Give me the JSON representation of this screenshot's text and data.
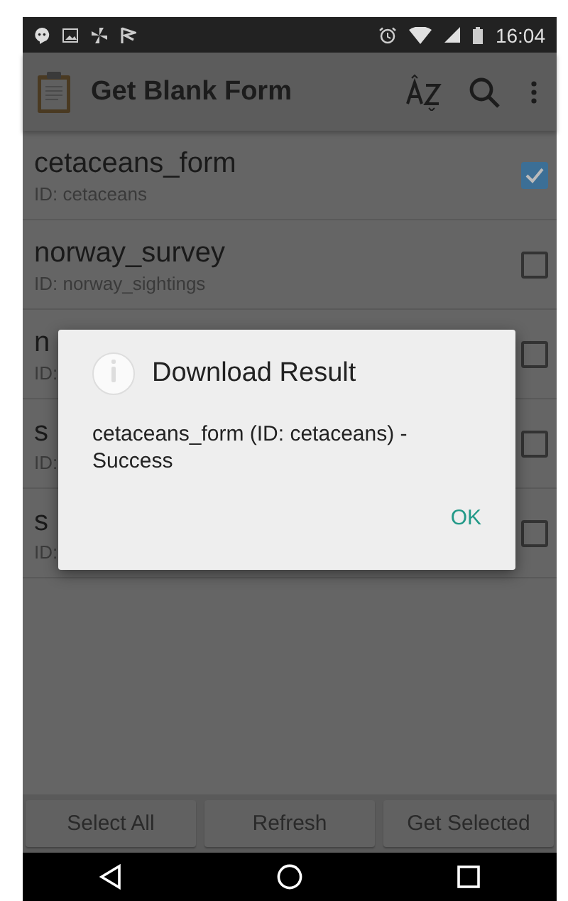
{
  "status_bar": {
    "time": "16:04"
  },
  "app_bar": {
    "title": "Get Blank Form"
  },
  "forms": [
    {
      "name": "cetaceans_form",
      "id_text": "ID: cetaceans",
      "checked": true
    },
    {
      "name": "norway_survey",
      "id_text": "ID: norway_sightings",
      "checked": false
    },
    {
      "name": "n",
      "id_text": "ID:",
      "checked": false
    },
    {
      "name": "s",
      "id_text": "ID:",
      "checked": false
    },
    {
      "name": "s",
      "id_text": "ID:",
      "checked": false
    }
  ],
  "buttons": [
    "Select All",
    "Refresh",
    "Get Selected"
  ],
  "dialog": {
    "title": "Download Result",
    "message": "cetaceans_form (ID: cetaceans) - Success",
    "button": "OK"
  }
}
